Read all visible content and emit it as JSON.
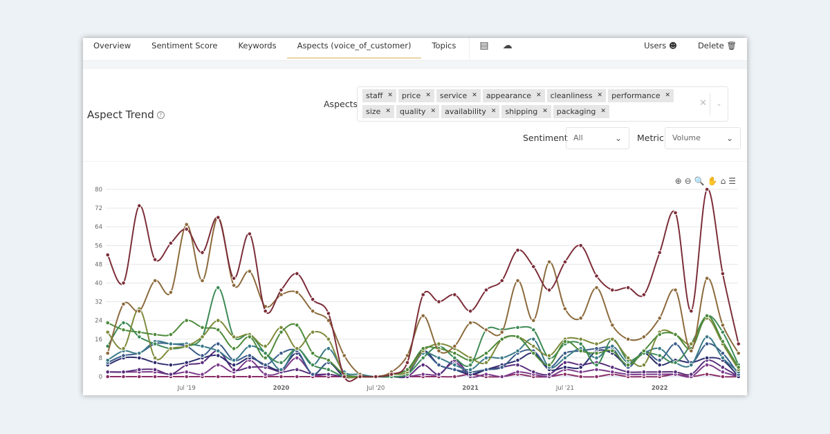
{
  "nav": {
    "tabs": [
      {
        "label": "Overview"
      },
      {
        "label": "Sentiment Score"
      },
      {
        "label": "Keywords"
      },
      {
        "label": "Aspects (voice_of_customer)",
        "active": true
      },
      {
        "label": "Topics"
      }
    ],
    "icons": [
      "document-icon",
      "cloud-icon"
    ],
    "users": "Users",
    "delete": "Delete"
  },
  "title": "Aspect Trend",
  "filters": {
    "aspects_label": "Aspects",
    "aspects": [
      "staff",
      "price",
      "service",
      "appearance",
      "cleanliness",
      "performance",
      "size",
      "quality",
      "availability",
      "shipping",
      "packaging"
    ],
    "sentiment_label": "Sentiment",
    "sentiment_value": "All",
    "metric_label": "Metric",
    "metric_value": "Volume"
  },
  "toolbar": [
    "zoom-in-icon",
    "zoom-out-icon",
    "selection-zoom-icon",
    "pan-icon",
    "home-icon",
    "menu-icon"
  ],
  "chart_data": {
    "type": "line",
    "title": "",
    "xlabel": "",
    "ylabel": "",
    "ylim": [
      0,
      80
    ],
    "yticks": [
      0,
      8,
      16,
      24,
      32,
      40,
      48,
      56,
      64,
      72,
      80
    ],
    "x_start": "2019-02",
    "x_end": "2022-06",
    "x_interval": "month",
    "xtick_labels": [
      {
        "label": "Jul '19",
        "at": "2019-07"
      },
      {
        "label": "2020",
        "at": "2020-01"
      },
      {
        "label": "Jul '20",
        "at": "2020-07"
      },
      {
        "label": "2021",
        "at": "2021-01"
      },
      {
        "label": "Jul '21",
        "at": "2021-07"
      },
      {
        "label": "2022",
        "at": "2022-01"
      }
    ],
    "grid": true,
    "legend": "none",
    "series": [
      {
        "color": "#7b2d38",
        "values": [
          52,
          40,
          73,
          50,
          57,
          63,
          53,
          68,
          42,
          61,
          28,
          37,
          44,
          33,
          27,
          0,
          0,
          0,
          1,
          6,
          35,
          32,
          35,
          28,
          37,
          41,
          54,
          47,
          37,
          49,
          56,
          43,
          37,
          38,
          35,
          53,
          70,
          28,
          80,
          44,
          14
        ]
      },
      {
        "color": "#8c6a3c",
        "values": [
          10,
          31,
          28,
          41,
          36,
          65,
          41,
          68,
          39,
          45,
          30,
          35,
          36,
          28,
          24,
          9,
          1,
          0,
          2,
          9,
          26,
          11,
          13,
          23,
          20,
          19,
          41,
          24,
          49,
          29,
          25,
          38,
          22,
          16,
          17,
          25,
          37,
          11,
          42,
          22,
          10
        ]
      },
      {
        "color": "#4d8a3a",
        "values": [
          23,
          20,
          19,
          18,
          18,
          24,
          21,
          20,
          12,
          17,
          8,
          19,
          22,
          10,
          7,
          1,
          0,
          0,
          1,
          3,
          12,
          12,
          10,
          7,
          10,
          16,
          17,
          10,
          5,
          15,
          11,
          10,
          11,
          5,
          11,
          18,
          18,
          12,
          26,
          15,
          4
        ]
      },
      {
        "color": "#7d8a3a",
        "values": [
          19,
          12,
          29,
          8,
          12,
          13,
          17,
          24,
          17,
          18,
          13,
          21,
          12,
          19,
          16,
          1,
          0,
          0,
          1,
          2,
          11,
          14,
          12,
          8,
          6,
          16,
          17,
          13,
          9,
          16,
          16,
          14,
          16,
          8,
          5,
          19,
          18,
          14,
          25,
          14,
          3
        ]
      },
      {
        "color": "#3d8a55",
        "values": [
          13,
          23,
          17,
          14,
          12,
          13,
          17,
          38,
          17,
          18,
          10,
          6,
          12,
          5,
          3,
          0,
          0,
          0,
          0,
          1,
          8,
          13,
          8,
          5,
          20,
          20,
          21,
          20,
          8,
          14,
          14,
          5,
          16,
          7,
          10,
          9,
          6,
          14,
          26,
          19,
          5
        ]
      },
      {
        "color": "#3a7a88",
        "values": [
          7,
          11,
          10,
          15,
          14,
          14,
          13,
          11,
          7,
          13,
          10,
          3,
          12,
          5,
          12,
          2,
          1,
          0,
          1,
          3,
          10,
          8,
          5,
          3,
          8,
          8,
          11,
          16,
          4,
          8,
          12,
          8,
          13,
          6,
          10,
          12,
          6,
          5,
          17,
          8,
          2
        ]
      },
      {
        "color": "#3a5c8a",
        "values": [
          6,
          9,
          10,
          14,
          14,
          13,
          9,
          14,
          7,
          9,
          5,
          10,
          11,
          1,
          6,
          1,
          0,
          0,
          0,
          1,
          10,
          5,
          3,
          2,
          3,
          4,
          10,
          11,
          4,
          10,
          11,
          12,
          12,
          4,
          11,
          7,
          14,
          6,
          14,
          10,
          1
        ]
      },
      {
        "color": "#2e2e70",
        "values": [
          5,
          8,
          8,
          6,
          5,
          6,
          8,
          9,
          5,
          8,
          5,
          3,
          10,
          1,
          6,
          0,
          0,
          0,
          0,
          1,
          11,
          5,
          3,
          1,
          3,
          5,
          7,
          10,
          3,
          4,
          4,
          11,
          10,
          5,
          10,
          5,
          7,
          6,
          8,
          7,
          0
        ]
      },
      {
        "color": "#5a2e7c",
        "values": [
          2,
          2,
          3,
          3,
          1,
          5,
          6,
          11,
          3,
          4,
          4,
          2,
          3,
          1,
          1,
          0,
          0,
          0,
          0,
          0,
          5,
          1,
          7,
          1,
          3,
          4,
          5,
          2,
          1,
          6,
          5,
          6,
          4,
          2,
          2,
          2,
          2,
          1,
          7,
          4,
          0
        ]
      },
      {
        "color": "#7c3a8a",
        "values": [
          2,
          2,
          2,
          2,
          1,
          2,
          1,
          5,
          2,
          7,
          1,
          2,
          8,
          1,
          1,
          0,
          0,
          0,
          0,
          0,
          1,
          1,
          6,
          0,
          1,
          0,
          2,
          1,
          0,
          3,
          2,
          3,
          2,
          1,
          1,
          1,
          1,
          0,
          5,
          2,
          0
        ]
      },
      {
        "color": "#8a2e66",
        "values": [
          0,
          0,
          0,
          0,
          0,
          0,
          0,
          0,
          0,
          0,
          0,
          0,
          0,
          0,
          0,
          0,
          0,
          0,
          0,
          0,
          0,
          0,
          0,
          1,
          0,
          0,
          1,
          0,
          0,
          1,
          0,
          0,
          1,
          0,
          0,
          0,
          1,
          0,
          1,
          0,
          0
        ]
      }
    ]
  }
}
